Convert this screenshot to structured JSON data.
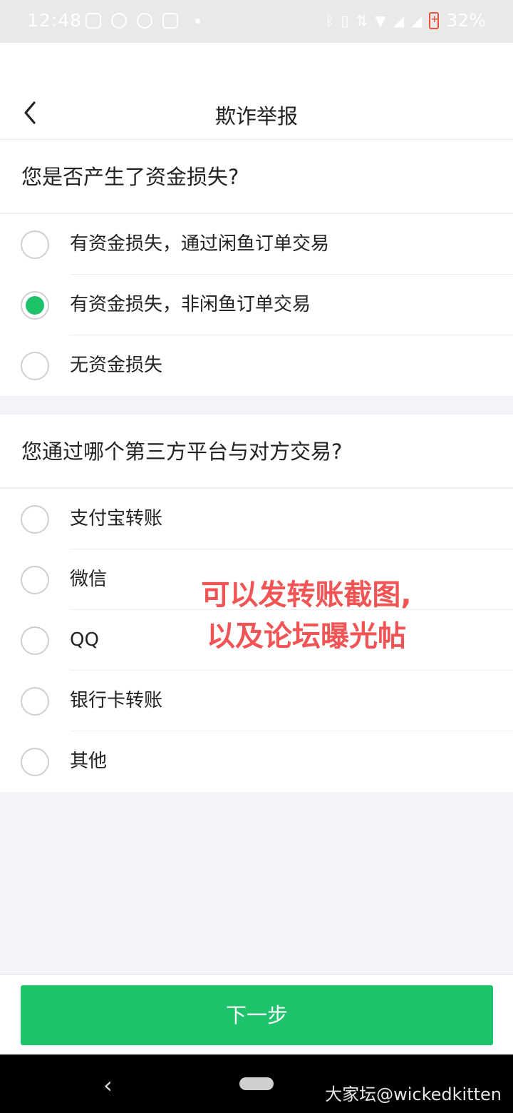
{
  "status_bar": {
    "time": "12:48",
    "left_icons": [
      "gallery-icon",
      "wechat-icon",
      "wechat-icon",
      "app-icon"
    ],
    "right_icons": [
      "bluetooth-icon",
      "vibrate-icon",
      "data-arrows-icon",
      "wifi-icon",
      "signal-icon",
      "signal-roaming-icon",
      "battery-charging-icon"
    ],
    "battery_percent": "32%"
  },
  "nav": {
    "title": "欺诈举报"
  },
  "section1": {
    "question": "您是否产生了资金损失?",
    "options": [
      {
        "label": "有资金损失，通过闲鱼订单交易",
        "selected": false
      },
      {
        "label": "有资金损失，非闲鱼订单交易",
        "selected": true
      },
      {
        "label": "无资金损失",
        "selected": false
      }
    ]
  },
  "section2": {
    "question": "您通过哪个第三方平台与对方交易?",
    "options": [
      {
        "label": "支付宝转账",
        "selected": false
      },
      {
        "label": "微信",
        "selected": false
      },
      {
        "label": "QQ",
        "selected": false
      },
      {
        "label": "银行卡转账",
        "selected": false
      },
      {
        "label": "其他",
        "selected": false
      }
    ]
  },
  "annotation": {
    "line1": "可以发转账截图,",
    "line2": "以及论坛曝光帖"
  },
  "footer": {
    "next_label": "下一步"
  },
  "watermark": "大家坛@wickedkitten",
  "colors": {
    "accent": "#1ec26a",
    "annotation": "#f05454"
  }
}
